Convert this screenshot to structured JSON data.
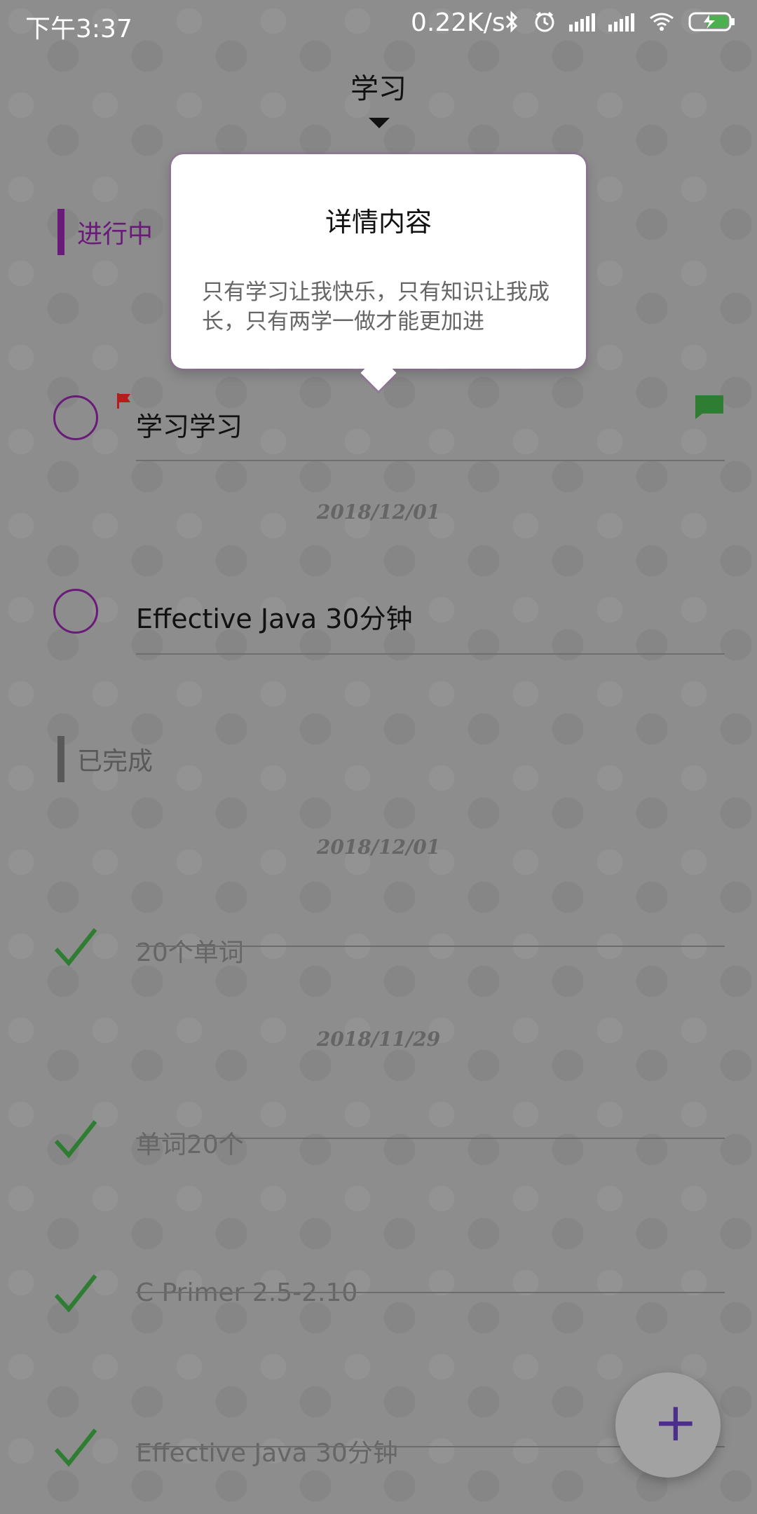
{
  "status_bar": {
    "time": "下午3:37",
    "network_speed": "0.22K/s",
    "icons": [
      "bluetooth-icon",
      "alarm-icon",
      "signal-icon",
      "signal-icon",
      "wifi-icon",
      "battery-icon"
    ]
  },
  "header": {
    "category": "学习",
    "dropdown_icon": "caret-down-icon"
  },
  "popover": {
    "title": "详情内容",
    "body": "只有学习让我快乐，只有知识让我成长，只有两学一做才能更加进"
  },
  "sections": {
    "in_progress": "进行中",
    "completed": "已完成"
  },
  "in_progress_items": [
    {
      "title": "学习学习",
      "flag": "red-flag-icon",
      "comment": "comment-icon"
    },
    {
      "title": "Effective Java 30分钟"
    }
  ],
  "dates": {
    "in_progress_group": "2018/12/01",
    "completed_group_1": "2018/12/01",
    "completed_group_2": "2018/11/29"
  },
  "completed_items": [
    {
      "title": "20个单词"
    },
    {
      "title": "单词20个"
    },
    {
      "title": "C Primer 2.5-2.10"
    },
    {
      "title": "Effective Java 30分钟"
    }
  ],
  "fab": {
    "label": "+"
  },
  "colors": {
    "accent": "#6a1b7a",
    "check": "#2e7d32",
    "flag": "#b71c1c"
  }
}
